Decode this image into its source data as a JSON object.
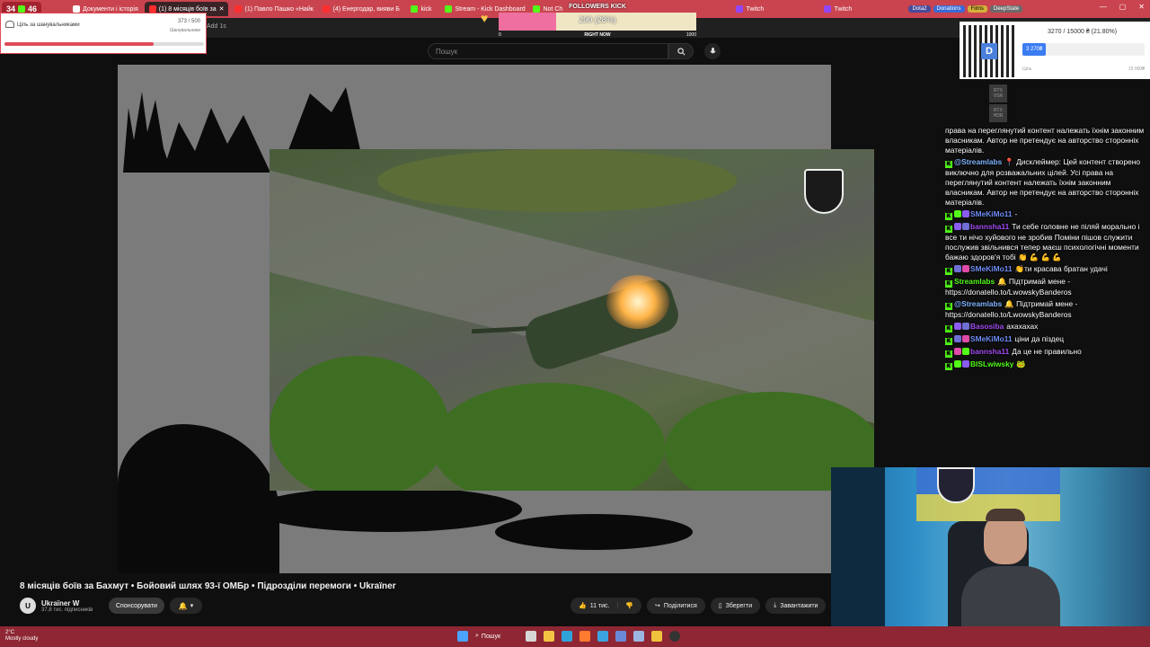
{
  "browser": {
    "tabs": [
      {
        "label": "Документи і історія"
      },
      {
        "label": "(1) 8 місяців боїв за"
      },
      {
        "label": "(1) Павло Пашко «Найк"
      },
      {
        "label": "(4) Енергодар, вияви Б"
      },
      {
        "label": "kick"
      },
      {
        "label": "Stream - Kick Dashboard"
      },
      {
        "label": "Not Ch"
      },
      {
        "label": "Twitch"
      },
      {
        "label": "Twitch"
      }
    ],
    "bookmarks": [
      "Dota2",
      "Donations",
      "Films",
      "DeepState"
    ],
    "address_fragment": "Add 1s"
  },
  "overlay_streak": "34",
  "overlay_kick_count": "46",
  "search": {
    "placeholder": "Пошук"
  },
  "video": {
    "title": "8 місяців боїв за Бахмут • Бойовий шлях 93-ї ОМБр • Підрозділи перемоги • Ukraїner",
    "channel": "Ukraїner W",
    "subscribers": "37,8 тис. підписників",
    "sponsor_label": "Спонсорувати",
    "likes": "11 тис.",
    "share_label": "Поділитися",
    "save_label": "Зберегти",
    "download_label": "Завантажити"
  },
  "goal_widget": {
    "title": "Ціль за шанувальниками",
    "count": "373 / 500",
    "sub": "Шанувальники",
    "progress": 0.746
  },
  "followers_widget": {
    "heading": "FOLLOWERS KICK",
    "value": "290 (28%)",
    "progress": 0.29,
    "min": "0",
    "mid": "RIGHT NOW",
    "max": "1000"
  },
  "donation_widget": {
    "amount": "3270 / 15000 ₴ (21.80%)",
    "button": "3 270₴",
    "label": "Ціль",
    "max": "15 000₴",
    "qr_letter": "D"
  },
  "rtx": [
    "RTX VSR",
    "RTX HDR"
  ],
  "chat": [
    {
      "user": "",
      "text": "права на переглянутий контент належать їхнім законним власникам. Автор не претендує на авторство сторонніх матеріалів.",
      "color": "#ffffff"
    },
    {
      "user": "@Streamlabs",
      "text": "📍 Дисклеймер: Цей контент створено виключно для розважальних цілей. Усі права на переглянутий контент належать їхнім законним власникам. Автор не претендує на авторство сторонніх матеріалів.",
      "color": "#7fb3ff"
    },
    {
      "user": "SMeKiMo11",
      "text": "-",
      "color": "#6f8df5"
    },
    {
      "user": "bannsha11",
      "text": "Ти себе головне не піляй морально і все ти нічо хуйового не зробив Поміни пішов служити послужив звільнився тепер маєш психологічні моменти бажаю здоров'я тобі 👏 💪 💪 💪",
      "color": "#a34cf0"
    },
    {
      "user": "SMeKiMo11",
      "text": "👏ти красава братан удачі",
      "color": "#6f8df5"
    },
    {
      "user": "Streamlabs",
      "text": "🔔 Підтримай мене - https://donatello.to/LwowskyBanderos",
      "color": "#53fc18"
    },
    {
      "user": "@Streamlabs",
      "text": "🔔 Підтримай мене - https://donatello.to/LwowskyBanderos",
      "color": "#7fb3ff"
    },
    {
      "user": "Basosiba",
      "text": "ахахахах",
      "color": "#a34cf0"
    },
    {
      "user": "SMeKiMo11",
      "text": "ціни да піздец",
      "color": "#6f8df5"
    },
    {
      "user": "bannsha11",
      "text": "Да це не правильно",
      "color": "#a34cf0"
    },
    {
      "user": "BISLwiwsky",
      "text": "🐸",
      "color": "#53fc18"
    }
  ],
  "taskbar": {
    "weather_temp": "2°C",
    "weather_desc": "Mostly cloudy",
    "search_label": "Пошук"
  },
  "colors": {
    "tabbar": "#c9444e",
    "taskbar": "#8e2733",
    "kick_green": "#53fc18",
    "follower_fill": "#ee6fa0"
  }
}
